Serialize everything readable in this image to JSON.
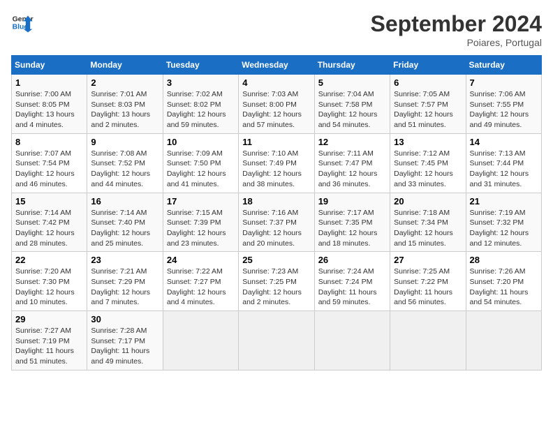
{
  "header": {
    "logo_line1": "General",
    "logo_line2": "Blue",
    "month": "September 2024",
    "location": "Poiares, Portugal"
  },
  "weekdays": [
    "Sunday",
    "Monday",
    "Tuesday",
    "Wednesday",
    "Thursday",
    "Friday",
    "Saturday"
  ],
  "weeks": [
    [
      {
        "day": "1",
        "sunrise": "7:00 AM",
        "sunset": "8:05 PM",
        "daylight": "13 hours and 4 minutes."
      },
      {
        "day": "2",
        "sunrise": "7:01 AM",
        "sunset": "8:03 PM",
        "daylight": "13 hours and 2 minutes."
      },
      {
        "day": "3",
        "sunrise": "7:02 AM",
        "sunset": "8:02 PM",
        "daylight": "12 hours and 59 minutes."
      },
      {
        "day": "4",
        "sunrise": "7:03 AM",
        "sunset": "8:00 PM",
        "daylight": "12 hours and 57 minutes."
      },
      {
        "day": "5",
        "sunrise": "7:04 AM",
        "sunset": "7:58 PM",
        "daylight": "12 hours and 54 minutes."
      },
      {
        "day": "6",
        "sunrise": "7:05 AM",
        "sunset": "7:57 PM",
        "daylight": "12 hours and 51 minutes."
      },
      {
        "day": "7",
        "sunrise": "7:06 AM",
        "sunset": "7:55 PM",
        "daylight": "12 hours and 49 minutes."
      }
    ],
    [
      {
        "day": "8",
        "sunrise": "7:07 AM",
        "sunset": "7:54 PM",
        "daylight": "12 hours and 46 minutes."
      },
      {
        "day": "9",
        "sunrise": "7:08 AM",
        "sunset": "7:52 PM",
        "daylight": "12 hours and 44 minutes."
      },
      {
        "day": "10",
        "sunrise": "7:09 AM",
        "sunset": "7:50 PM",
        "daylight": "12 hours and 41 minutes."
      },
      {
        "day": "11",
        "sunrise": "7:10 AM",
        "sunset": "7:49 PM",
        "daylight": "12 hours and 38 minutes."
      },
      {
        "day": "12",
        "sunrise": "7:11 AM",
        "sunset": "7:47 PM",
        "daylight": "12 hours and 36 minutes."
      },
      {
        "day": "13",
        "sunrise": "7:12 AM",
        "sunset": "7:45 PM",
        "daylight": "12 hours and 33 minutes."
      },
      {
        "day": "14",
        "sunrise": "7:13 AM",
        "sunset": "7:44 PM",
        "daylight": "12 hours and 31 minutes."
      }
    ],
    [
      {
        "day": "15",
        "sunrise": "7:14 AM",
        "sunset": "7:42 PM",
        "daylight": "12 hours and 28 minutes."
      },
      {
        "day": "16",
        "sunrise": "7:14 AM",
        "sunset": "7:40 PM",
        "daylight": "12 hours and 25 minutes."
      },
      {
        "day": "17",
        "sunrise": "7:15 AM",
        "sunset": "7:39 PM",
        "daylight": "12 hours and 23 minutes."
      },
      {
        "day": "18",
        "sunrise": "7:16 AM",
        "sunset": "7:37 PM",
        "daylight": "12 hours and 20 minutes."
      },
      {
        "day": "19",
        "sunrise": "7:17 AM",
        "sunset": "7:35 PM",
        "daylight": "12 hours and 18 minutes."
      },
      {
        "day": "20",
        "sunrise": "7:18 AM",
        "sunset": "7:34 PM",
        "daylight": "12 hours and 15 minutes."
      },
      {
        "day": "21",
        "sunrise": "7:19 AM",
        "sunset": "7:32 PM",
        "daylight": "12 hours and 12 minutes."
      }
    ],
    [
      {
        "day": "22",
        "sunrise": "7:20 AM",
        "sunset": "7:30 PM",
        "daylight": "12 hours and 10 minutes."
      },
      {
        "day": "23",
        "sunrise": "7:21 AM",
        "sunset": "7:29 PM",
        "daylight": "12 hours and 7 minutes."
      },
      {
        "day": "24",
        "sunrise": "7:22 AM",
        "sunset": "7:27 PM",
        "daylight": "12 hours and 4 minutes."
      },
      {
        "day": "25",
        "sunrise": "7:23 AM",
        "sunset": "7:25 PM",
        "daylight": "12 hours and 2 minutes."
      },
      {
        "day": "26",
        "sunrise": "7:24 AM",
        "sunset": "7:24 PM",
        "daylight": "11 hours and 59 minutes."
      },
      {
        "day": "27",
        "sunrise": "7:25 AM",
        "sunset": "7:22 PM",
        "daylight": "11 hours and 56 minutes."
      },
      {
        "day": "28",
        "sunrise": "7:26 AM",
        "sunset": "7:20 PM",
        "daylight": "11 hours and 54 minutes."
      }
    ],
    [
      {
        "day": "29",
        "sunrise": "7:27 AM",
        "sunset": "7:19 PM",
        "daylight": "11 hours and 51 minutes."
      },
      {
        "day": "30",
        "sunrise": "7:28 AM",
        "sunset": "7:17 PM",
        "daylight": "11 hours and 49 minutes."
      },
      null,
      null,
      null,
      null,
      null
    ]
  ]
}
